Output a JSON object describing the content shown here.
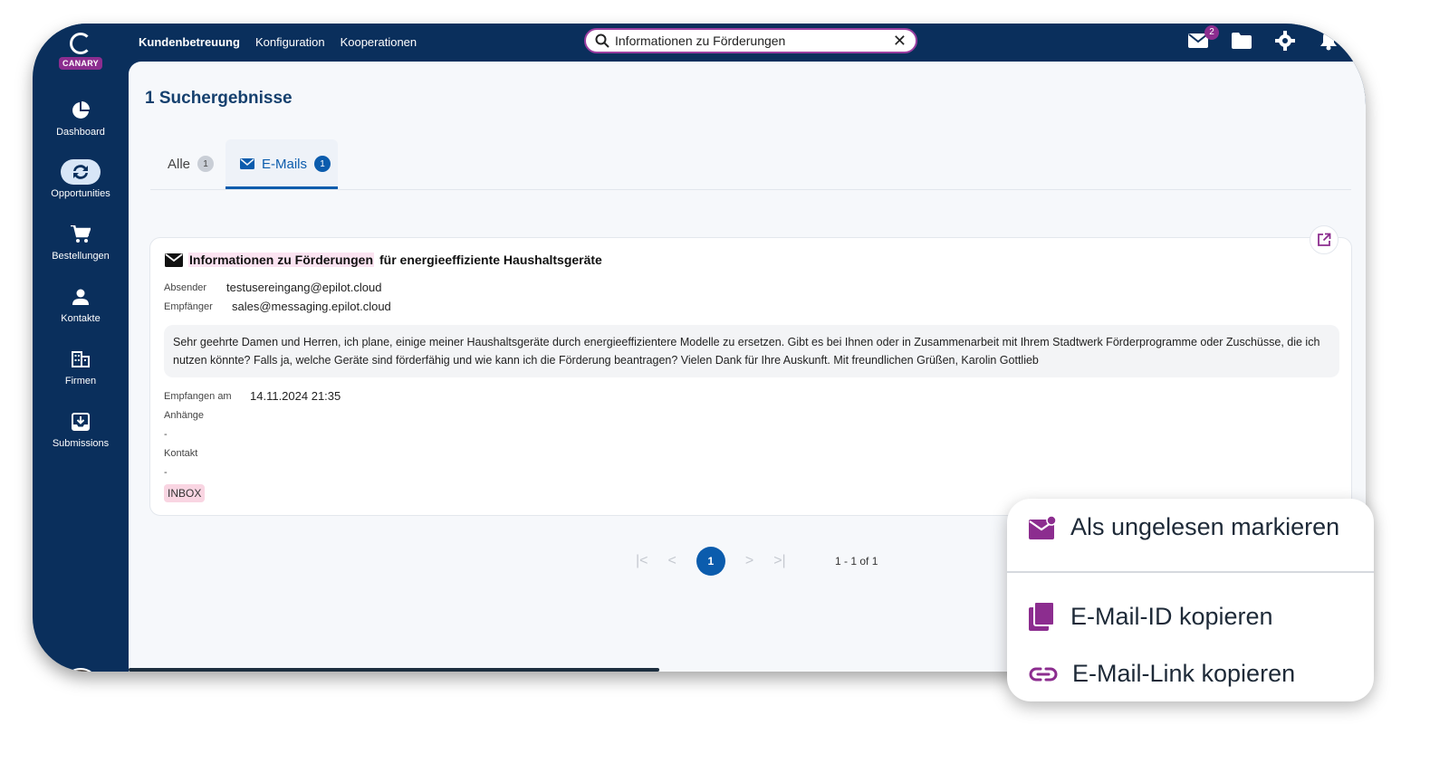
{
  "brand": {
    "badge": "CANARY"
  },
  "topnav": {
    "items": [
      {
        "label": "Kundenbetreuung",
        "active": true
      },
      {
        "label": "Konfiguration",
        "active": false
      },
      {
        "label": "Kooperationen",
        "active": false
      }
    ]
  },
  "search": {
    "value": "Informationen zu Förderungen"
  },
  "top_icons": {
    "mail_count": "2"
  },
  "sidebar": {
    "items": [
      {
        "label": "Dashboard",
        "icon": "pie-chart-icon"
      },
      {
        "label": "Opportunities",
        "icon": "sync-icon",
        "active": true
      },
      {
        "label": "Bestellungen",
        "icon": "cart-icon"
      },
      {
        "label": "Kontakte",
        "icon": "person-icon"
      },
      {
        "label": "Firmen",
        "icon": "building-icon"
      },
      {
        "label": "Submissions",
        "icon": "inbox-download-icon"
      }
    ]
  },
  "results": {
    "title": "1 Suchergebnisse"
  },
  "tabs": [
    {
      "label": "Alle",
      "count": "1"
    },
    {
      "label": "E-Mails",
      "count": "1",
      "active": true
    }
  ],
  "email": {
    "subject_highlight": "Informationen zu Förderungen",
    "subject_rest": "für energieeffiziente Haushaltsgeräte",
    "sender_label": "Absender",
    "sender": "testusereingang@epilot.cloud",
    "recipient_label": "Empfänger",
    "recipient": "sales@messaging.epilot.cloud",
    "body": "Sehr geehrte Damen und Herren, ich plane, einige meiner Haushaltsgeräte durch energieeffizientere Modelle zu ersetzen. Gibt es bei Ihnen oder in Zusammenarbeit mit Ihrem Stadtwerk Förderprogramme oder Zuschüsse, die ich nutzen könnte? Falls ja, welche Geräte sind förderfähig und wie kann ich die Förderung beantragen? Vielen Dank für Ihre Auskunft. Mit freundlichen Grüßen, Karolin Gottlieb",
    "received_label": "Empfangen am",
    "received": "14.11.2024 21:35",
    "attachments_label": "Anhänge",
    "attachments": "-",
    "contact_label": "Kontakt",
    "contact": "-",
    "tag": "INBOX"
  },
  "pagination": {
    "current": "1",
    "range": "1 - 1 of 1"
  },
  "context_menu": {
    "items": [
      {
        "label": "Als ungelesen markieren",
        "icon": "mark-unread-icon"
      },
      {
        "label": "E-Mail-ID kopieren",
        "icon": "copy-icon"
      },
      {
        "label": "E-Mail-Link kopieren",
        "icon": "link-icon"
      }
    ]
  },
  "colors": {
    "navy": "#0a2f5c",
    "accent_purple": "#8c2d8f",
    "primary_blue": "#0b5cad",
    "highlight_pink": "#fbe3f1"
  }
}
